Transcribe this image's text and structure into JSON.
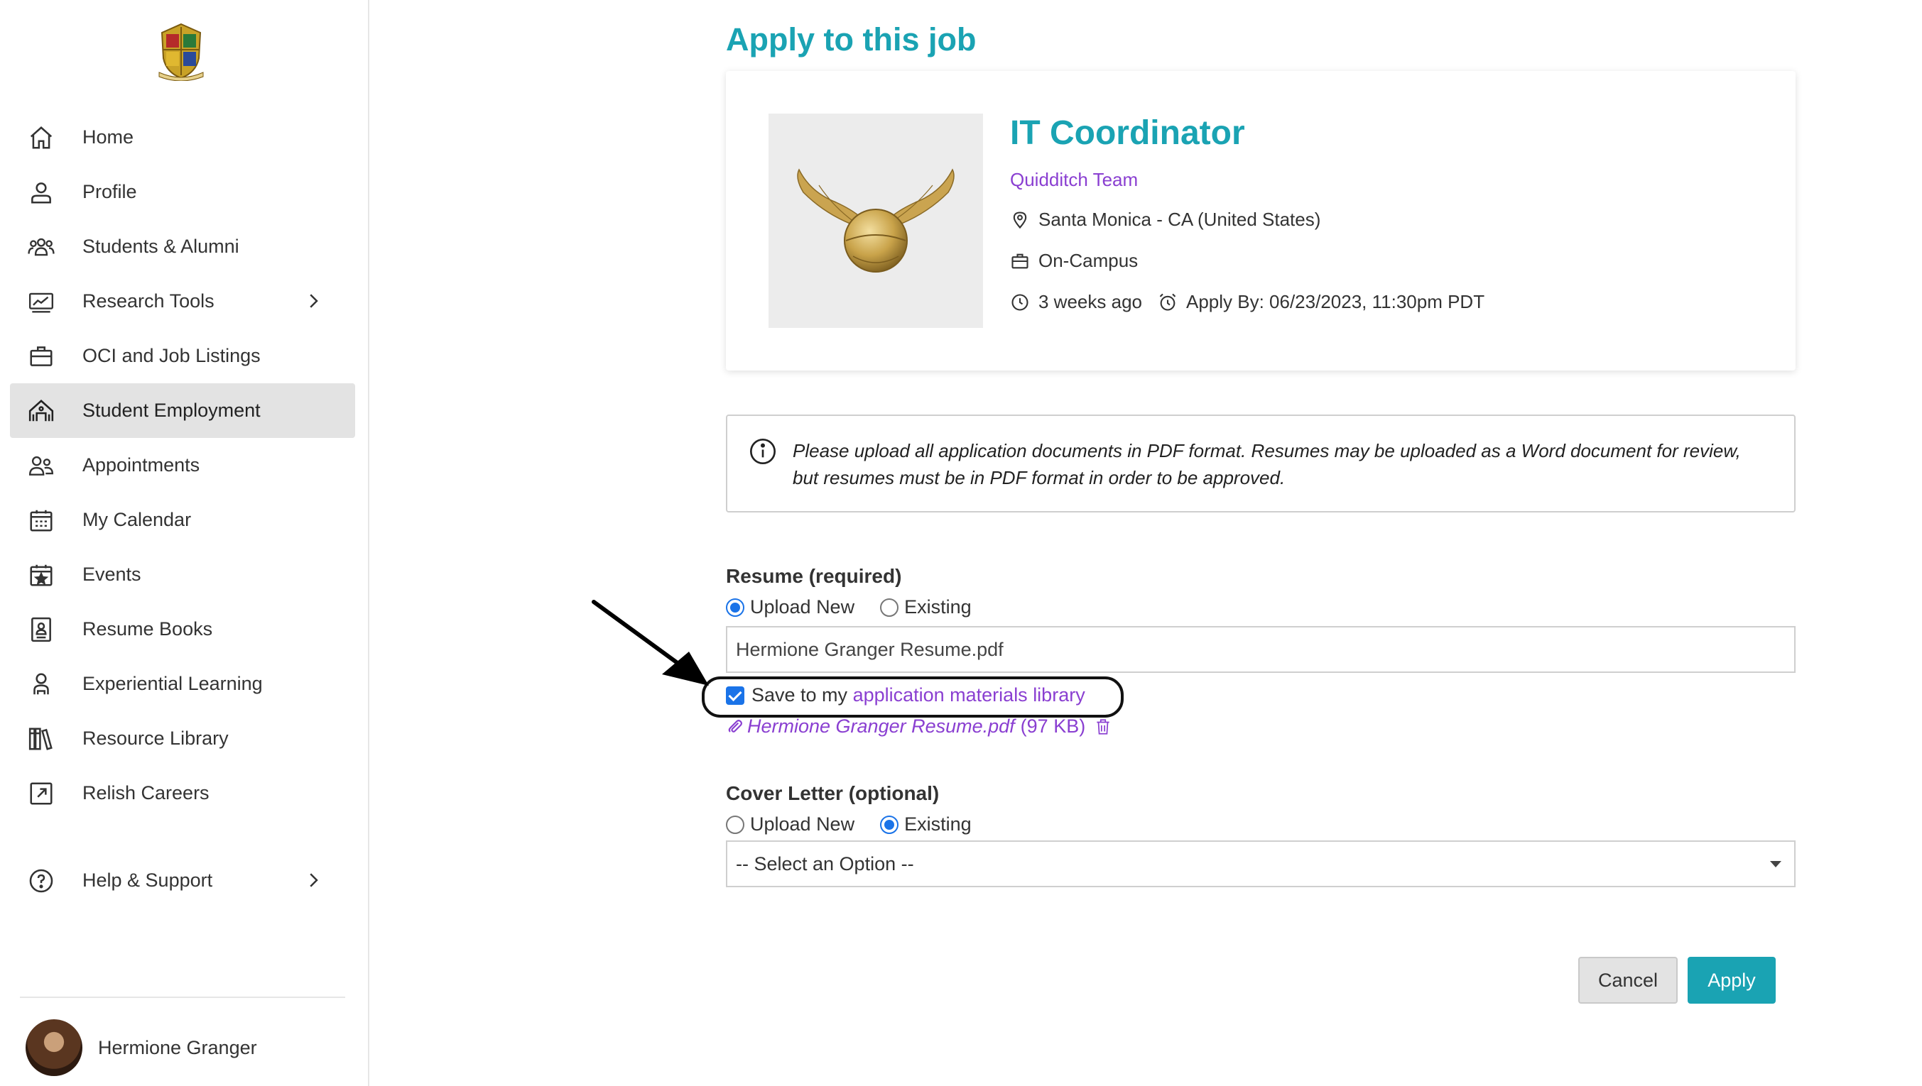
{
  "sidebar": {
    "logo_icon": "hogwarts-crest-icon",
    "items": [
      {
        "label": "Home",
        "icon": "home-icon"
      },
      {
        "label": "Profile",
        "icon": "user-icon"
      },
      {
        "label": "Students & Alumni",
        "icon": "people-icon"
      },
      {
        "label": "Research Tools",
        "icon": "chart-icon",
        "has_submenu": true
      },
      {
        "label": "OCI and Job Listings",
        "icon": "briefcase-icon"
      },
      {
        "label": "Student Employment",
        "icon": "building-icon",
        "active": true
      },
      {
        "label": "Appointments",
        "icon": "appointments-icon"
      },
      {
        "label": "My Calendar",
        "icon": "calendar-icon"
      },
      {
        "label": "Events",
        "icon": "event-star-icon"
      },
      {
        "label": "Resume Books",
        "icon": "resume-book-icon"
      },
      {
        "label": "Experiential Learning",
        "icon": "learning-icon"
      },
      {
        "label": "Resource Library",
        "icon": "library-icon"
      },
      {
        "label": "Relish Careers",
        "icon": "external-link-icon"
      }
    ],
    "help": {
      "label": "Help & Support",
      "icon": "help-circle-icon"
    },
    "user": {
      "name": "Hermione Granger"
    }
  },
  "main": {
    "title": "Apply to this job",
    "job": {
      "title": "IT Coordinator",
      "employer": "Quidditch Team",
      "location": "Santa Monica - CA (United States)",
      "type": "On-Campus",
      "posted": "3 weeks ago",
      "apply_by": "Apply By: 06/23/2023, 11:30pm PDT"
    },
    "notice": "Please upload all application documents in PDF format. Resumes may be uploaded as a Word document for review, but resumes must be in PDF format in order to be approved.",
    "resume": {
      "label": "Resume (required)",
      "option_upload": "Upload New",
      "option_existing": "Existing",
      "selected": "Upload New",
      "file_value": "Hermione Granger Resume.pdf",
      "save_prefix": "Save to my ",
      "save_link": "application materials library",
      "save_checked": true,
      "attachment_name": "Hermione Granger Resume.pdf",
      "attachment_size": "(97 KB)"
    },
    "cover_letter": {
      "label": "Cover Letter (optional)",
      "option_upload": "Upload New",
      "option_existing": "Existing",
      "selected": "Existing",
      "select_value": "-- Select an Option --"
    },
    "buttons": {
      "cancel": "Cancel",
      "apply": "Apply"
    }
  },
  "colors": {
    "accent": "#1aa3b3",
    "link": "#8a3fd1",
    "active_bg": "#e3e3e3"
  }
}
